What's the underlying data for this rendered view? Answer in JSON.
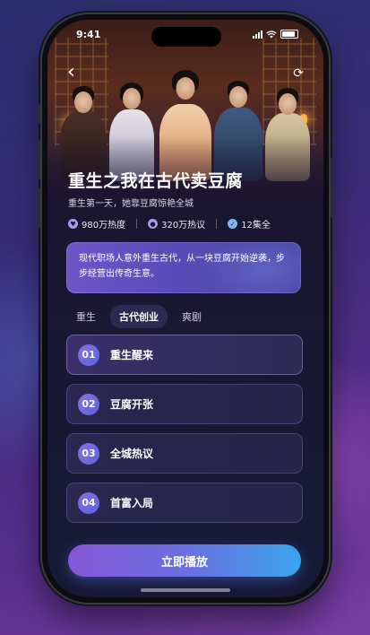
{
  "status_bar": {
    "time": "9:41"
  },
  "show": {
    "title": "重生之我在古代卖豆腐",
    "subtitle": "重生第一天，她靠豆腐惊艳全城",
    "stats": [
      {
        "icon": "heart-icon",
        "text": "980万热度",
        "color": "#a99ae8"
      },
      {
        "icon": "chat-icon",
        "text": "320万热议",
        "color": "#a99ae8"
      },
      {
        "icon": "check-icon",
        "text": "12集全",
        "color": "#7fb8f0"
      }
    ],
    "description": "现代职场人意外重生古代，从一块豆腐开始逆袭，步步经营出传奇生意。"
  },
  "tabs": [
    {
      "label": "重生",
      "active": false
    },
    {
      "label": "古代创业",
      "active": true
    },
    {
      "label": "爽剧",
      "active": false
    }
  ],
  "episodes": [
    {
      "num": "01",
      "name": "重生醒来"
    },
    {
      "num": "02",
      "name": "豆腐开张"
    },
    {
      "num": "03",
      "name": "全城热议"
    },
    {
      "num": "04",
      "name": "首富入局"
    }
  ],
  "cta": {
    "label": "立即播放"
  },
  "colors": {
    "accent_start": "#8656d8",
    "accent_end": "#3aa5ec",
    "screen_bg": "#1b1430"
  }
}
